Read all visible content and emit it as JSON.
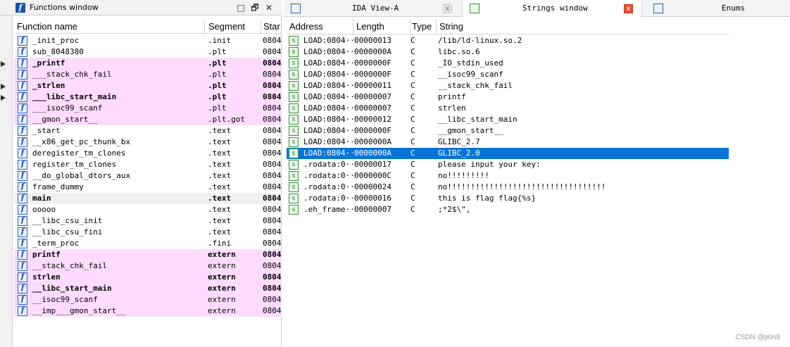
{
  "functions_window": {
    "title": "Functions window",
    "icon": "function-f-icon",
    "buttons": {
      "restore": "□",
      "float": "🗗",
      "close": "✕"
    },
    "columns": [
      "Function name",
      "Segment",
      "Star"
    ],
    "rows": [
      {
        "name": "_init_proc",
        "segment": ".init",
        "start": "0804",
        "style": "normal"
      },
      {
        "name": "sub_8048380",
        "segment": ".plt",
        "start": "0804",
        "style": "normal"
      },
      {
        "name": "_printf",
        "segment": ".plt",
        "start": "0804",
        "style": "lib-bold"
      },
      {
        "name": "___stack_chk_fail",
        "segment": ".plt",
        "start": "0804",
        "style": "lib"
      },
      {
        "name": "_strlen",
        "segment": ".plt",
        "start": "0804",
        "style": "lib-bold"
      },
      {
        "name": "___libc_start_main",
        "segment": ".plt",
        "start": "0804",
        "style": "lib-bold"
      },
      {
        "name": "___isoc99_scanf",
        "segment": ".plt",
        "start": "0804",
        "style": "lib"
      },
      {
        "name": "__gmon_start__",
        "segment": ".plt.got",
        "start": "0804",
        "style": "lib"
      },
      {
        "name": "_start",
        "segment": ".text",
        "start": "0804",
        "style": "normal"
      },
      {
        "name": "__x86_get_pc_thunk_bx",
        "segment": ".text",
        "start": "0804",
        "style": "normal"
      },
      {
        "name": "deregister_tm_clones",
        "segment": ".text",
        "start": "0804",
        "style": "normal"
      },
      {
        "name": "register_tm_clones",
        "segment": ".text",
        "start": "0804",
        "style": "normal"
      },
      {
        "name": "__do_global_dtors_aux",
        "segment": ".text",
        "start": "0804",
        "style": "normal"
      },
      {
        "name": "frame_dummy",
        "segment": ".text",
        "start": "0804",
        "style": "normal"
      },
      {
        "name": "main",
        "segment": ".text",
        "start": "0804",
        "style": "sel-bold"
      },
      {
        "name": "ooooo",
        "segment": ".text",
        "start": "0804",
        "style": "normal"
      },
      {
        "name": "__libc_csu_init",
        "segment": ".text",
        "start": "0804",
        "style": "normal"
      },
      {
        "name": "__libc_csu_fini",
        "segment": ".text",
        "start": "0804",
        "style": "normal"
      },
      {
        "name": "_term_proc",
        "segment": ".fini",
        "start": "0804",
        "style": "normal"
      },
      {
        "name": "printf",
        "segment": "extern",
        "start": "0804",
        "style": "lib-bold"
      },
      {
        "name": "__stack_chk_fail",
        "segment": "extern",
        "start": "0804",
        "style": "lib"
      },
      {
        "name": "strlen",
        "segment": "extern",
        "start": "0804",
        "style": "lib-bold"
      },
      {
        "name": "__libc_start_main",
        "segment": "extern",
        "start": "0804",
        "style": "lib-bold"
      },
      {
        "name": "__isoc99_scanf",
        "segment": "extern",
        "start": "0804",
        "style": "lib"
      },
      {
        "name": "__imp___gmon_start__",
        "segment": "extern",
        "start": "0804",
        "style": "lib"
      }
    ]
  },
  "tabs": [
    {
      "label": "IDA View-A",
      "icon": "ida-view-icon",
      "active": false,
      "close": "x"
    },
    {
      "label": "Strings window",
      "icon": "strings-icon",
      "active": true,
      "close": "x"
    },
    {
      "label": "Enums",
      "icon": "enums-icon",
      "active": false,
      "close": ""
    }
  ],
  "strings_window": {
    "columns": [
      "Address",
      "Length",
      "Type",
      "String"
    ],
    "selected_index": 10,
    "rows": [
      {
        "address": "LOAD:0804···",
        "length": "00000013",
        "type": "C",
        "string": "/lib/ld-linux.so.2"
      },
      {
        "address": "LOAD:0804···",
        "length": "0000000A",
        "type": "C",
        "string": "libc.so.6"
      },
      {
        "address": "LOAD:0804···",
        "length": "0000000F",
        "type": "C",
        "string": "_IO_stdin_used"
      },
      {
        "address": "LOAD:0804···",
        "length": "0000000F",
        "type": "C",
        "string": "__isoc99_scanf"
      },
      {
        "address": "LOAD:0804···",
        "length": "00000011",
        "type": "C",
        "string": "__stack_chk_fail"
      },
      {
        "address": "LOAD:0804···",
        "length": "00000007",
        "type": "C",
        "string": "printf"
      },
      {
        "address": "LOAD:0804···",
        "length": "00000007",
        "type": "C",
        "string": "strlen"
      },
      {
        "address": "LOAD:0804···",
        "length": "00000012",
        "type": "C",
        "string": "__libc_start_main"
      },
      {
        "address": "LOAD:0804···",
        "length": "0000000F",
        "type": "C",
        "string": "__gmon_start__"
      },
      {
        "address": "LOAD:0804···",
        "length": "0000000A",
        "type": "C",
        "string": "GLIBC_2.7"
      },
      {
        "address": "LOAD:0804···",
        "length": "0000000A",
        "type": "C",
        "string": "GLIBC_2.0"
      },
      {
        "address": ".rodata:0···",
        "length": "00000017",
        "type": "C",
        "string": "please input your key:"
      },
      {
        "address": ".rodata:0···",
        "length": "0000000C",
        "type": "C",
        "string": "no!!!!!!!!!"
      },
      {
        "address": ".rodata:0···",
        "length": "00000024",
        "type": "C",
        "string": "no!!!!!!!!!!!!!!!!!!!!!!!!!!!!!!!!!!"
      },
      {
        "address": ".rodata:0···",
        "length": "00000016",
        "type": "C",
        "string": "this is flag flag{%s}"
      },
      {
        "address": ".eh_frame···",
        "length": "00000007",
        "type": "C",
        "string": ";*2$\\\","
      }
    ]
  },
  "watermark": "CSDN @p0n9",
  "colors": {
    "lib_row_bg": "#ffdcff",
    "selection_bg": "#0a74d6",
    "close_red": "#e8503a"
  }
}
